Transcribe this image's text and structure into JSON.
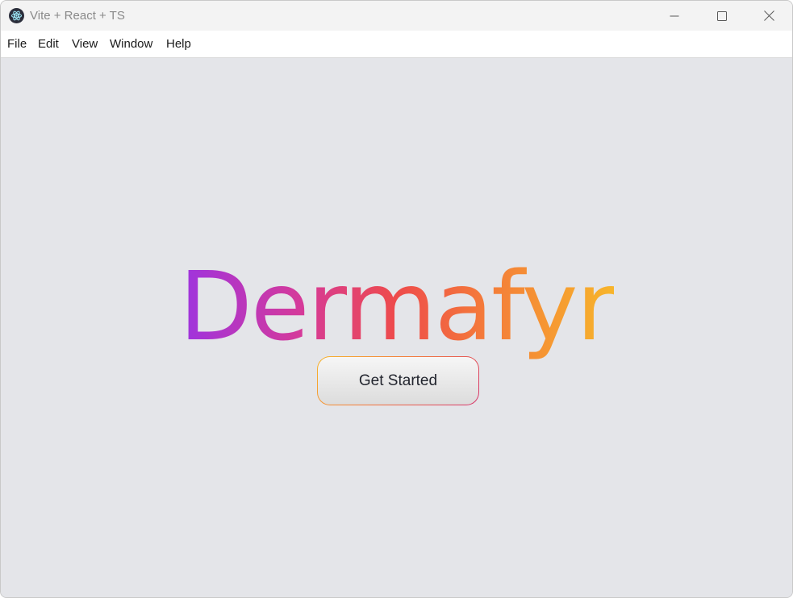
{
  "window": {
    "title": "Vite + React + TS",
    "controls": {
      "minimize_icon": "minimize-icon",
      "maximize_icon": "maximize-icon",
      "close_icon": "close-icon"
    }
  },
  "menubar": {
    "items": [
      {
        "label": "File"
      },
      {
        "label": "Edit"
      },
      {
        "label": "View"
      },
      {
        "label": "Window"
      },
      {
        "label": "Help"
      }
    ]
  },
  "main": {
    "brand": "Dermafyr",
    "cta_label": "Get Started"
  },
  "colors": {
    "background": "#e4e5e9",
    "gradient_start": "#9d33e0",
    "gradient_mid": "#ee4b4b",
    "gradient_end": "#f7b52b",
    "button_text": "#22252e"
  }
}
